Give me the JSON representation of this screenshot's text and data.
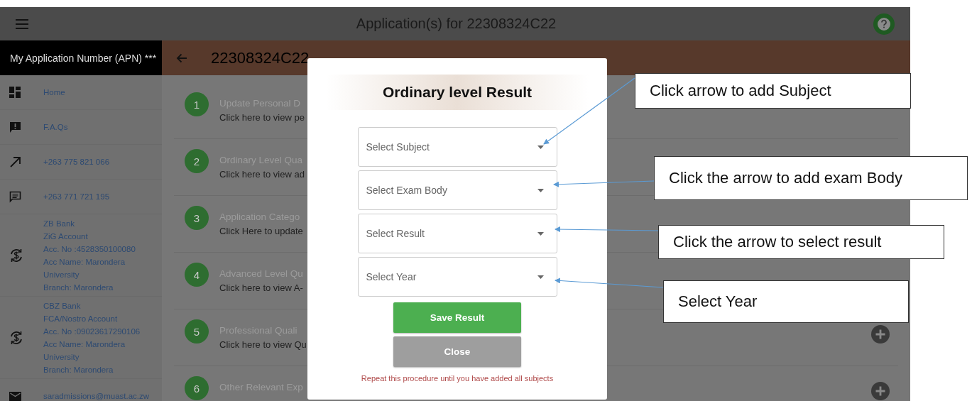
{
  "top_bar": {
    "title": "Application(s) for 22308324C22"
  },
  "sidebar": {
    "header": "My Application Number (APN) ***",
    "items": [
      {
        "kind": "dashboard",
        "lines": [
          "Home"
        ]
      },
      {
        "kind": "faq",
        "lines": [
          "F.A.Qs"
        ]
      },
      {
        "kind": "arrow",
        "lines": [
          "+263 775 821 066"
        ]
      },
      {
        "kind": "chat",
        "lines": [
          "+263 771 721 195"
        ]
      },
      {
        "kind": "currency",
        "lines": [
          "ZB Bank",
          "ZiG Account",
          "Acc. No :4528350100080",
          "Acc Name: Marondera",
          "University",
          "Branch: Marondera"
        ]
      },
      {
        "kind": "currency",
        "lines": [
          "CBZ Bank",
          "FCA/Nostro Account",
          "Acc. No :09023617290106",
          "Acc Name: Marondera",
          "University",
          "Branch: Marondera"
        ]
      },
      {
        "kind": "mail",
        "lines": [
          "saradmissions@muast.ac.zw"
        ]
      }
    ]
  },
  "page_header": {
    "title": "22308324C22"
  },
  "steps": [
    {
      "number": "1",
      "title": "Update Personal D",
      "subtitle": "Click here to view pe",
      "add_button": false
    },
    {
      "number": "2",
      "title": "Ordinary Level Qua",
      "subtitle": "Click here to view ad",
      "add_button": false
    },
    {
      "number": "3",
      "title": "Application Catego",
      "subtitle": "Click Here to update",
      "add_button": false
    },
    {
      "number": "4",
      "title": "Advanced Level Qu",
      "subtitle": "Click here to view  A-",
      "add_button": false
    },
    {
      "number": "5",
      "title": "Professional Quali",
      "subtitle": "Click here to view Qu",
      "add_button": true
    },
    {
      "number": "6",
      "title": "Other Relevant Exp",
      "add_button": true
    }
  ],
  "dialog": {
    "title": "Ordinary level Result",
    "fields": [
      {
        "placeholder": "Select Subject"
      },
      {
        "placeholder": "Select Exam Body"
      },
      {
        "placeholder": "Select Result"
      },
      {
        "placeholder": "Select Year"
      }
    ],
    "buttons": [
      {
        "kind": "primary",
        "label": "Save Result"
      },
      {
        "kind": "secondary",
        "label": "Close"
      }
    ],
    "note": "Repeat this procedure until you have added all subjects"
  },
  "callouts": [
    {
      "text": "Click arrow to add Subject"
    },
    {
      "text": "Click the arrow to add exam Body"
    },
    {
      "text": "Click the arrow to select result"
    },
    {
      "text": "Select Year"
    }
  ]
}
